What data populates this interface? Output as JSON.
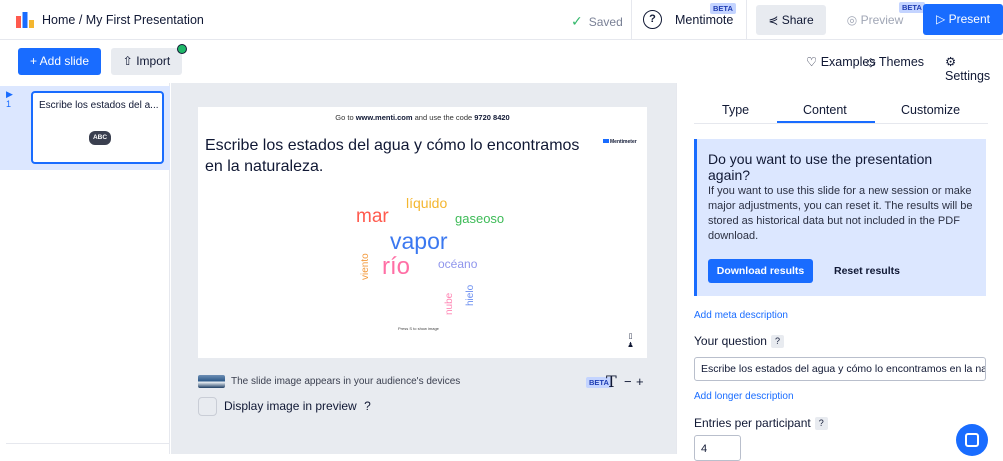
{
  "header": {
    "breadcrumb": "Home / My First Presentation",
    "saved_label": "Saved",
    "help_symbol": "?",
    "mentimote_label": "Mentimote",
    "mentimote_badge": "BETA",
    "share_label": "Share",
    "preview_label": "Preview",
    "preview_badge": "BETA",
    "present_label": "Present"
  },
  "toolbar": {
    "add_slide_label": "+ Add slide",
    "import_label": "Import",
    "examples_label": "Examples",
    "themes_label": "Themes",
    "settings_label": "Settings"
  },
  "slides": [
    {
      "number": "1",
      "title": "Escribe los estados del a...",
      "icon_text": "ABC"
    }
  ],
  "slide": {
    "join_prefix": "Go to ",
    "join_url": "www.menti.com",
    "join_middle": " and use the code ",
    "join_code": "9720 8420",
    "question": "Escribe los estados del agua y cómo lo encontramos en la naturaleza.",
    "brand": "Mentimeter",
    "press_hint": "Press S to show image",
    "words": [
      {
        "text": "líquido",
        "color": "#f4b62f"
      },
      {
        "text": "mar",
        "color": "#ff5a4e"
      },
      {
        "text": "gaseoso",
        "color": "#3dbb57"
      },
      {
        "text": "vapor",
        "color": "#3b78f0"
      },
      {
        "text": "río",
        "color": "#ff6fa5"
      },
      {
        "text": "océano",
        "color": "#8f95ec"
      },
      {
        "text": "viento",
        "color": "#f39a3c"
      },
      {
        "text": "hielo",
        "color": "#6c8ff0"
      },
      {
        "text": "nube",
        "color": "#ff86b4"
      }
    ]
  },
  "image_row": {
    "text": "The slide image appears in your audience's devices",
    "badge": "BETA",
    "text_icon": "T",
    "minus": "−",
    "plus": "+"
  },
  "preview_checkbox": {
    "label": "Display image in preview",
    "help": "?"
  },
  "right_panel": {
    "tabs": [
      "Type",
      "Content",
      "Customize"
    ],
    "active_tab": "Content",
    "info_title": "Do you want to use the presentation again?",
    "info_body": "If you want to use this slide for a new session or make major adjustments, you can reset it. The results will be stored as historical data but not included in the PDF download.",
    "download_label": "Download results",
    "reset_label": "Reset results",
    "meta_link": "Add meta description",
    "question_label": "Your question",
    "question_help": "?",
    "question_value": "Escribe los estados del agua y cómo lo encontramos en la naturaleza.",
    "longer_link": "Add longer description",
    "entries_label": "Entries per participant",
    "entries_help": "?",
    "entries_value": "4"
  },
  "colors": {
    "accent": "#196cff",
    "selected_bg": "#dce7ff",
    "canvas_bg": "#e8ebf0",
    "saved_check": "#33b86b"
  },
  "icons": [
    "mentimeter-logo-icon",
    "check-icon",
    "help-icon",
    "share-icon",
    "eye-icon",
    "play-icon",
    "upload-icon",
    "lightbulb-icon",
    "themes-icon",
    "gear-icon",
    "chat-icon",
    "person-icon"
  ]
}
